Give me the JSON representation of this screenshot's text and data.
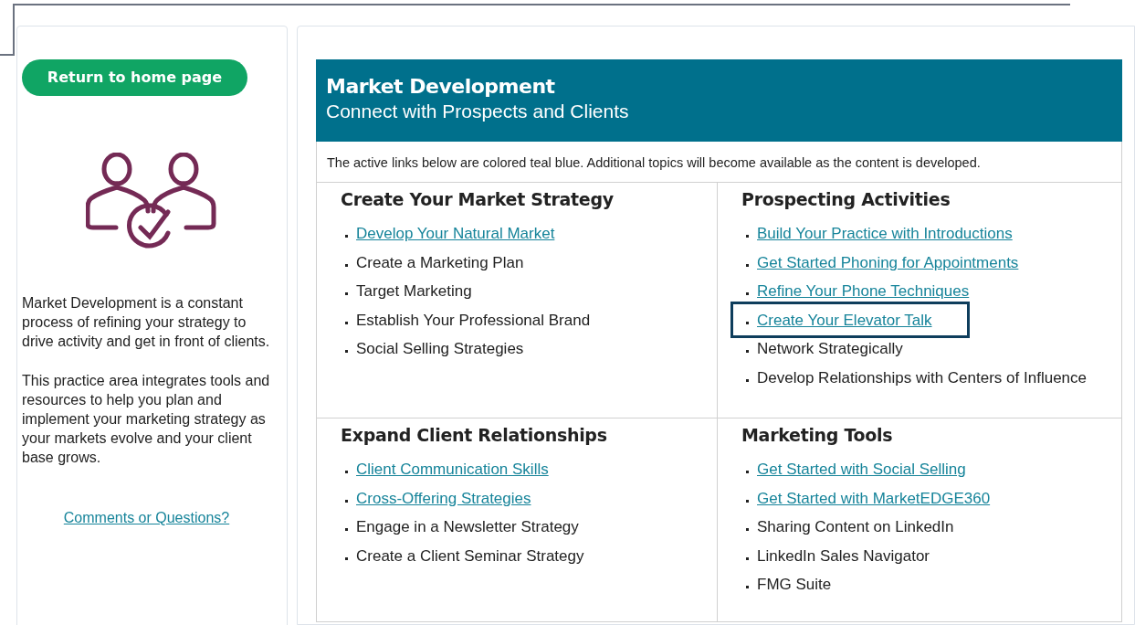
{
  "sidebar": {
    "home_button": "Return to home page",
    "paragraphs": [
      "Market Development is a constant process of refining your strategy to drive activity and get in front of clients.",
      "This practice area integrates tools and resources to help you plan and implement your marketing strategy as your markets evolve and your client base grows."
    ],
    "comments_link": "Comments or Questions?"
  },
  "header": {
    "title": "Market Development",
    "subtitle": "Connect with Prospects and Clients"
  },
  "notice": "The active links below are colored teal blue. Additional topics will become available as the content is developed.",
  "sections": [
    {
      "title": "Create Your Market Strategy",
      "items": [
        {
          "label": "Develop Your Natural Market",
          "kind": "link",
          "focused": false
        },
        {
          "label": "Create a Marketing Plan",
          "kind": "text",
          "focused": false
        },
        {
          "label": "Target Marketing",
          "kind": "text",
          "focused": false
        },
        {
          "label": "Establish Your Professional Brand",
          "kind": "text",
          "focused": false
        },
        {
          "label": "Social Selling Strategies",
          "kind": "text",
          "focused": false
        }
      ]
    },
    {
      "title": "Prospecting Activities",
      "items": [
        {
          "label": "Build Your Practice with Introductions",
          "kind": "link",
          "focused": false
        },
        {
          "label": "Get Started Phoning for Appointments",
          "kind": "link",
          "focused": false
        },
        {
          "label": "Refine Your Phone Techniques",
          "kind": "link",
          "focused": false
        },
        {
          "label": "Create Your Elevator Talk",
          "kind": "link",
          "focused": true
        },
        {
          "label": "Network Strategically",
          "kind": "text",
          "focused": false
        },
        {
          "label": "Develop Relationships with Centers of Influence",
          "kind": "text",
          "focused": false
        }
      ]
    },
    {
      "title": "Expand Client Relationships",
      "items": [
        {
          "label": "Client Communication Skills",
          "kind": "link",
          "focused": false
        },
        {
          "label": "Cross-Offering Strategies",
          "kind": "link",
          "focused": false
        },
        {
          "label": "Engage in a Newsletter Strategy",
          "kind": "text",
          "focused": false
        },
        {
          "label": "Create a Client Seminar Strategy",
          "kind": "text",
          "focused": false
        }
      ]
    },
    {
      "title": "Marketing Tools",
      "items": [
        {
          "label": "Get Started with Social Selling",
          "kind": "link",
          "focused": false
        },
        {
          "label": "Get Started with MarketEDGE360",
          "kind": "link",
          "focused": false
        },
        {
          "label": "Sharing Content on LinkedIn",
          "kind": "text",
          "focused": false
        },
        {
          "label": "LinkedIn Sales Navigator",
          "kind": "text",
          "focused": false
        },
        {
          "label": "FMG Suite",
          "kind": "text",
          "focused": false
        }
      ]
    }
  ]
}
